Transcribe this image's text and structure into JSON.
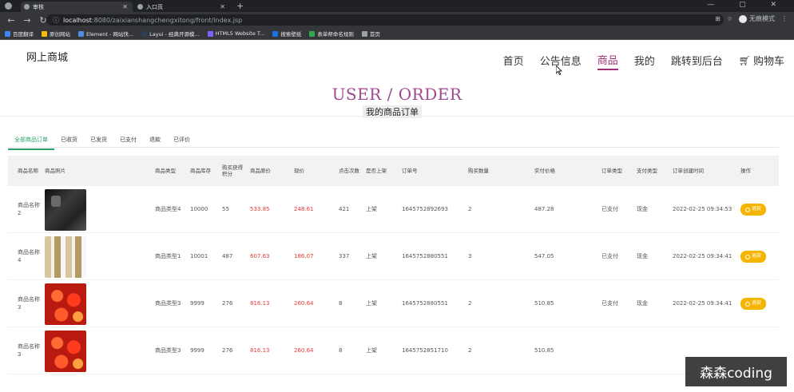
{
  "browser": {
    "tabs": [
      {
        "label": "审核"
      },
      {
        "label": "入口页"
      }
    ],
    "new_tab_label": "+",
    "window_controls": "— ▢ ✕",
    "url_host": "localhost",
    "url_path": ":8080/zaixianshangchengxitong/front/index.jsp",
    "incognito_label": "无痕模式",
    "bookmarks": [
      {
        "label": "百度翻译",
        "color": "#4285f4"
      },
      {
        "label": "原创网站",
        "color": "#fbbc05"
      },
      {
        "label": "Element - 网站快...",
        "color": "#4a90e2"
      },
      {
        "label": "Layui - 经典开源模...",
        "color": "#2f4056"
      },
      {
        "label": "HTML5 Website T...",
        "color": "#7b61ff"
      },
      {
        "label": "搜索壁纸",
        "color": "#1a73e8"
      },
      {
        "label": "表单帮命名规则",
        "color": "#34a853"
      },
      {
        "label": "首页",
        "color": "#9aa0a6"
      }
    ]
  },
  "site": {
    "logo": "网上商城",
    "nav": [
      {
        "label": "首页",
        "active": false
      },
      {
        "label": "公告信息",
        "active": false
      },
      {
        "label": "商品",
        "active": true
      },
      {
        "label": "我的",
        "active": false
      },
      {
        "label": "跳转到后台",
        "active": false
      },
      {
        "label": "购物车",
        "active": false
      }
    ],
    "hero_title": "USER / ORDER",
    "hero_subtitle": "我的商品订单"
  },
  "order_tabs": [
    {
      "label": "全部商品订单",
      "active": true
    },
    {
      "label": "已收货",
      "active": false
    },
    {
      "label": "已发货",
      "active": false
    },
    {
      "label": "已支付",
      "active": false
    },
    {
      "label": "退款",
      "active": false
    },
    {
      "label": "已评价",
      "active": false
    }
  ],
  "table": {
    "headers": [
      "商品名称",
      "商品照片",
      "商品类型",
      "商品库存",
      "购买获得积分",
      "商品原价",
      "现价",
      "点击次数",
      "是否上架",
      "订单号",
      "购买数量",
      "实付价格",
      "订单类型",
      "支付类型",
      "订单创建时间",
      "操作"
    ],
    "rows": [
      {
        "name": "商品名称2",
        "photo": "phone",
        "type": "商品类型4",
        "stock": "10000",
        "points": "55",
        "orig": "533.85",
        "price": "248.61",
        "clicks": "421",
        "onsale": "上架",
        "order_no": "1645752892693",
        "qty": "2",
        "paid": "487.28",
        "order_type": "已支付",
        "pay_type": "现金",
        "created": "2022-02-25 09:34:53",
        "action": "退款"
      },
      {
        "name": "商品名称4",
        "photo": "bottles",
        "type": "商品类型1",
        "stock": "10001",
        "points": "487",
        "orig": "607.63",
        "price": "186.07",
        "clicks": "337",
        "onsale": "上架",
        "order_no": "1645752880551",
        "qty": "3",
        "paid": "547.05",
        "order_type": "已支付",
        "pay_type": "现金",
        "created": "2022-02-25 09:34:41",
        "action": "退款"
      },
      {
        "name": "商品名称3",
        "photo": "flowers",
        "type": "商品类型3",
        "stock": "9999",
        "points": "276",
        "orig": "816.13",
        "price": "260.64",
        "clicks": "8",
        "onsale": "上架",
        "order_no": "1645752880551",
        "qty": "2",
        "paid": "510.85",
        "order_type": "已支付",
        "pay_type": "现金",
        "created": "2022-02-25 09:34:41",
        "action": "退款"
      },
      {
        "name": "商品名称3",
        "photo": "flowers",
        "type": "商品类型3",
        "stock": "9999",
        "points": "276",
        "orig": "816.13",
        "price": "260.64",
        "clicks": "8",
        "onsale": "上架",
        "order_no": "1645752851710",
        "qty": "2",
        "paid": "510.85",
        "order_type": "",
        "pay_type": "",
        "created": "",
        "action": ""
      }
    ]
  },
  "watermark": "森森coding",
  "colors": {
    "accent": "#9e2f72",
    "tab_active": "#2aa36a",
    "price_red": "#e53935",
    "refund_button": "#f5b400"
  }
}
